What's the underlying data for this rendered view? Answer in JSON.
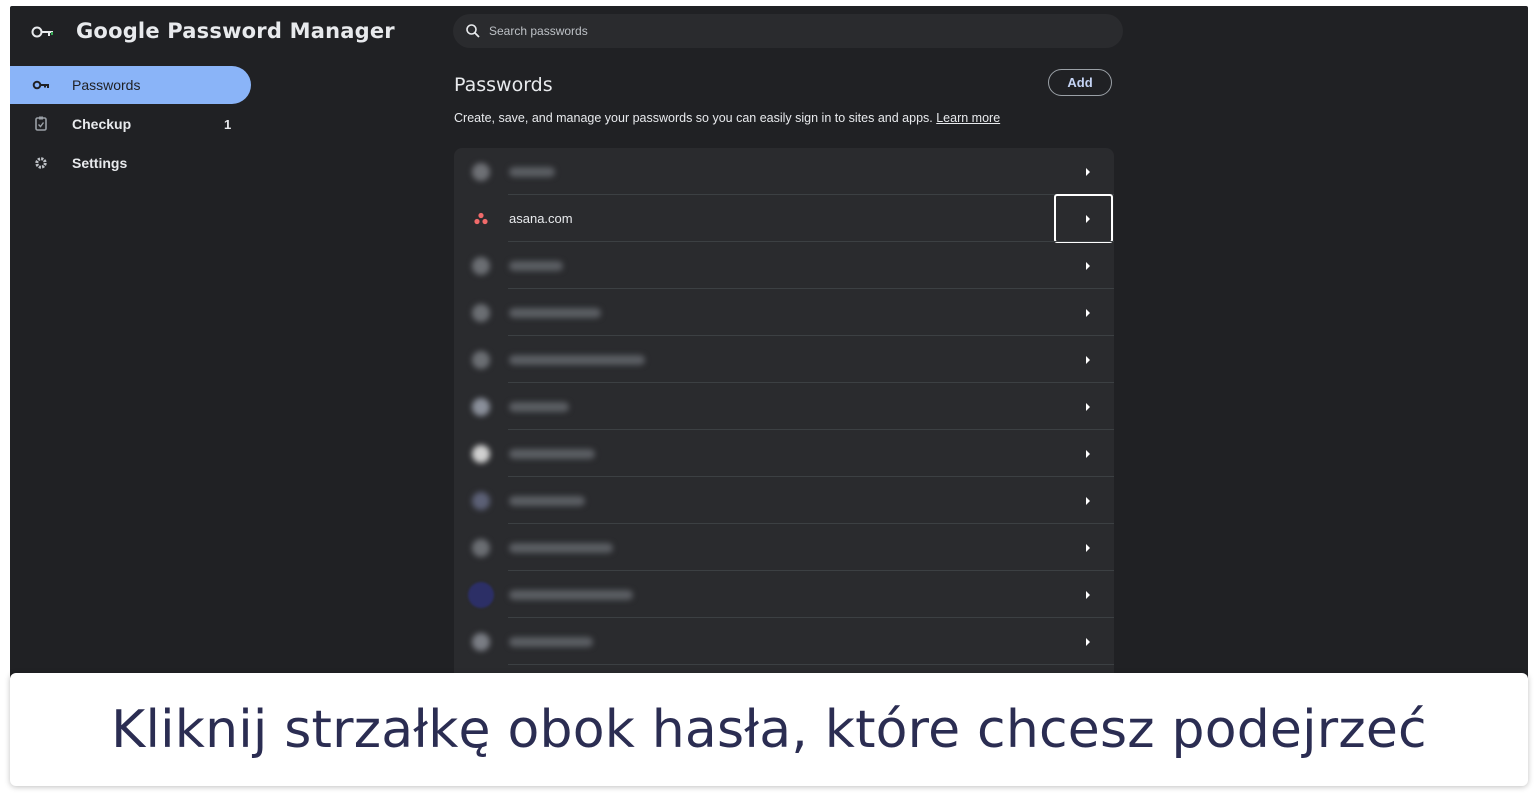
{
  "app": {
    "title": "Google Password Manager",
    "logo_icon": "key-icon",
    "accent_color": "#8ab4f8",
    "background_color": "#202124"
  },
  "search": {
    "placeholder": "Search passwords",
    "value": ""
  },
  "sidebar": {
    "items": [
      {
        "label": "Passwords",
        "icon": "key-icon",
        "active": true
      },
      {
        "label": "Checkup",
        "icon": "checkup-icon",
        "badge": "1"
      },
      {
        "label": "Settings",
        "icon": "gear-icon"
      }
    ]
  },
  "main": {
    "title": "Passwords",
    "add_label": "Add",
    "description": "Create, save, and manage your passwords so you can easily sign in to sites and apps.",
    "learn_more": "Learn more"
  },
  "password_list": {
    "visible_site": "asana.com",
    "visible_site_icon": "asana-logo-icon",
    "row_count": 11,
    "highlighted_row": 2,
    "chevron_icon": "chevron-right-icon"
  },
  "caption": {
    "text": "Kliknij strzałkę obok hasła, które chcesz podejrzeć"
  }
}
